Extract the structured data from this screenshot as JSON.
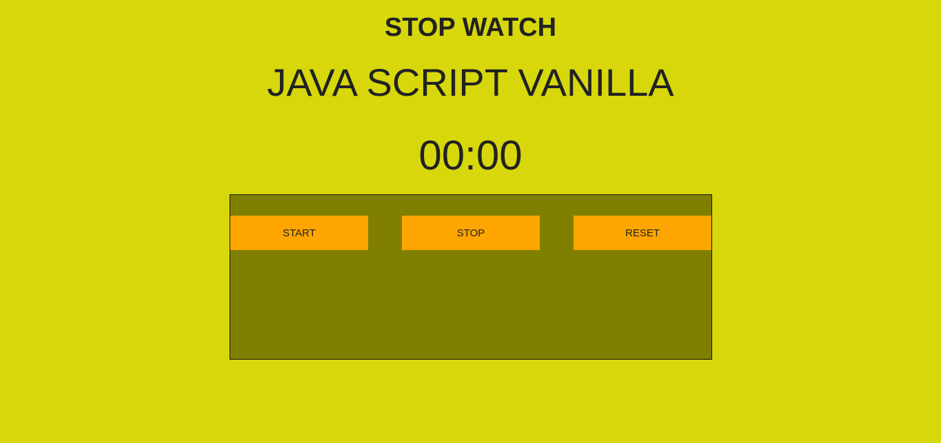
{
  "header": {
    "title": "STOP WATCH",
    "subtitle": "JAVA SCRIPT VANILLA"
  },
  "timer": {
    "display": "00:00"
  },
  "controls": {
    "start_label": "START",
    "stop_label": "STOP",
    "reset_label": "RESET"
  },
  "colors": {
    "page_background": "#d7d70c",
    "panel_background": "#808000",
    "button_background": "#ffa500",
    "text": "#222222"
  }
}
